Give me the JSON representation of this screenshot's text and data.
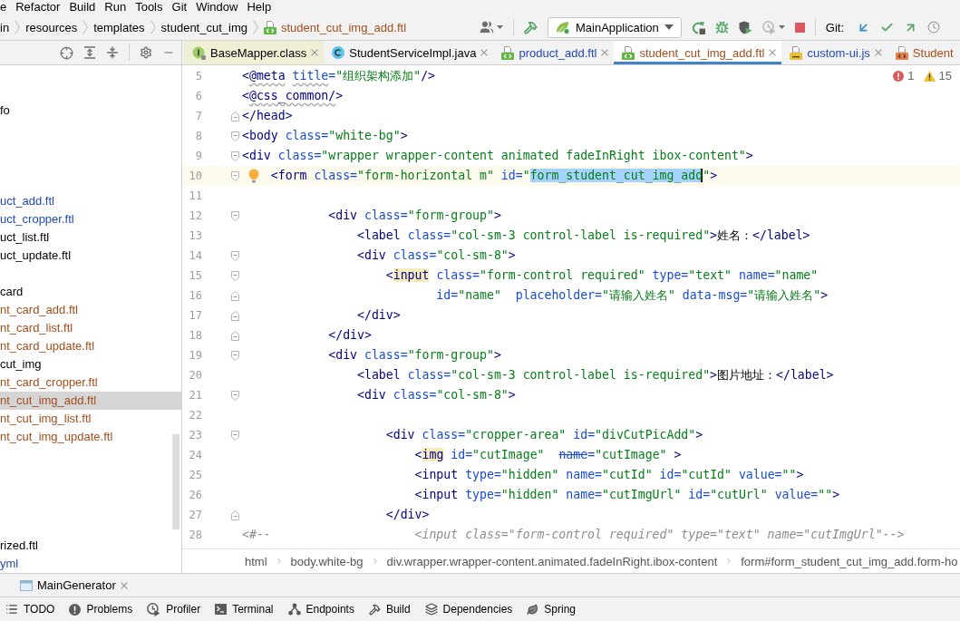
{
  "menu_bar": {
    "items": [
      "e",
      "Refactor",
      "Build",
      "Run",
      "Tools",
      "Git",
      "Window",
      "Help"
    ]
  },
  "nav_bar": {
    "breadcrumbs": [
      {
        "label": "in",
        "kind": "folder"
      },
      {
        "label": "resources",
        "kind": "folder"
      },
      {
        "label": "templates",
        "kind": "folder"
      },
      {
        "label": "student_cut_img",
        "kind": "folder"
      },
      {
        "label": "student_cut_img_add.ftl",
        "kind": "ftl",
        "color": "#a34e1c"
      }
    ]
  },
  "toolbar": {
    "run_config": "MainApplication",
    "run_actions": [
      {
        "kind": "rerun",
        "disabled": false
      },
      {
        "kind": "debug",
        "disabled": false
      },
      {
        "kind": "coverage",
        "disabled": false
      },
      {
        "kind": "profile",
        "disabled": true
      },
      {
        "kind": "stop",
        "disabled": false
      }
    ],
    "git_label": "Git:"
  },
  "project_tree": {
    "groups": [
      {
        "items": [
          {
            "label": "fo",
            "selected": false
          }
        ]
      },
      {
        "items": [
          {
            "label": "uct_add.ftl",
            "color": "#2148b8",
            "selected": false
          },
          {
            "label": "uct_cropper.ftl",
            "color": "#2148b8",
            "selected": false
          },
          {
            "label": "uct_list.ftl",
            "selected": false
          },
          {
            "label": "uct_update.ftl",
            "selected": false
          }
        ]
      },
      {
        "items": [
          {
            "label": "card",
            "selected": false
          },
          {
            "label": "nt_card_add.ftl",
            "color": "#a34e1c",
            "selected": false
          },
          {
            "label": "nt_card_list.ftl",
            "color": "#a34e1c",
            "selected": false
          },
          {
            "label": "nt_card_update.ftl",
            "color": "#a34e1c",
            "selected": false
          },
          {
            "label": "cut_img",
            "selected": false
          },
          {
            "label": "nt_card_cropper.ftl",
            "color": "#a34e1c",
            "selected": false
          },
          {
            "label": "nt_cut_img_add.ftl",
            "color": "#a34e1c",
            "selected": true
          },
          {
            "label": "nt_cut_img_list.ftl",
            "color": "#a34e1c",
            "selected": false
          },
          {
            "label": "nt_cut_img_update.ftl",
            "color": "#a34e1c",
            "selected": false
          }
        ]
      },
      {
        "items": [
          {
            "label": "rized.ftl",
            "selected": false
          },
          {
            "label": "yml",
            "color": "#2148b8",
            "selected": false
          }
        ]
      }
    ]
  },
  "editor": {
    "tabs": [
      {
        "label": "BaseMapper.class",
        "kind": "interface",
        "library": true,
        "selected": false
      },
      {
        "label": "StudentServiceImpl.java",
        "kind": "class",
        "library": false,
        "selected": false
      },
      {
        "label": "product_add.ftl",
        "kind": "ftl",
        "color": "#2148b8",
        "library": false,
        "selected": false
      },
      {
        "label": "student_cut_img_add.ftl",
        "kind": "ftl",
        "color": "#a34e1c",
        "library": false,
        "selected": true
      },
      {
        "label": "custom-ui.js",
        "kind": "js",
        "color": "#2148b8",
        "library": false,
        "selected": false
      },
      {
        "label": "Student",
        "kind": "html",
        "color": "#a34e1c",
        "library": false,
        "selected": false
      }
    ],
    "inspections": {
      "errors": "1",
      "warnings": "15"
    },
    "lines": [
      {
        "number": "5",
        "kind": "code",
        "segments": [
          {
            "text": "<"
          },
          {
            "text": "@meta title",
            "kind": "warning"
          },
          {
            "text": "=\"组织架构添加\"/>"
          }
        ]
      },
      {
        "number": "6",
        "kind": "code",
        "segments": [
          {
            "text": "<"
          },
          {
            "text": "@css_common/",
            "kind": "warning"
          },
          {
            "text": ">"
          }
        ]
      },
      {
        "number": "7",
        "kind": "code",
        "fold_end": true,
        "segments": [
          {
            "text": "</head>"
          }
        ]
      },
      {
        "number": "8",
        "kind": "code",
        "fold_start": true,
        "segments": [
          {
            "text": "<body class=\"white-bg\">"
          }
        ]
      },
      {
        "number": "9",
        "kind": "code",
        "fold_start": true,
        "segments": [
          {
            "text": "<div class=\"wrapper wrapper-content animated fadeInRight ibox-content\">"
          }
        ]
      },
      {
        "number": "10",
        "kind": "code",
        "fold_start": true,
        "current": true,
        "bulb": true,
        "segments": [
          {
            "text": "    <form class=\"form-horizontal m\" id=\""
          },
          {
            "text": "form_student_cut_img_add",
            "kind": "selection"
          },
          {
            "text": "\">"
          }
        ]
      },
      {
        "number": "11",
        "kind": "code"
      },
      {
        "number": "12",
        "kind": "code",
        "fold_start": true,
        "segments": [
          {
            "text": "            <div class=\"form-group\">"
          }
        ]
      },
      {
        "number": "13",
        "kind": "code",
        "segments": [
          {
            "text": "                <label class=\"col-sm-3 control-label is-required\">姓名：</label>"
          }
        ]
      },
      {
        "number": "14",
        "kind": "code",
        "fold_start": true,
        "segments": [
          {
            "text": "                <div class=\"col-sm-8\">"
          }
        ]
      },
      {
        "number": "15",
        "kind": "code",
        "fold_start": true,
        "segments": [
          {
            "text": "                    <"
          },
          {
            "text": "input",
            "kind": "highlight"
          },
          {
            "text": " class=\"form-control required\" type=\"text\" name=\"name\""
          }
        ]
      },
      {
        "number": "16",
        "kind": "code",
        "fold_end": true,
        "segments": [
          {
            "text": "                           id=\"name\"  placeholder=\"请输入姓名\" data-msg=\"请输入姓名\">"
          }
        ]
      },
      {
        "number": "17",
        "kind": "code",
        "fold_end": true,
        "segments": [
          {
            "text": "                </div>"
          }
        ]
      },
      {
        "number": "18",
        "kind": "code",
        "fold_end": true,
        "segments": [
          {
            "text": "            </div>"
          }
        ]
      },
      {
        "number": "19",
        "kind": "code",
        "fold_start": true,
        "segments": [
          {
            "text": "            <div class=\"form-group\">"
          }
        ]
      },
      {
        "number": "20",
        "kind": "code",
        "segments": [
          {
            "text": "                <label class=\"col-sm-3 control-label is-required\">图片地址：</label>"
          }
        ]
      },
      {
        "number": "21",
        "kind": "code",
        "fold_start": true,
        "segments": [
          {
            "text": "                <div class=\"col-sm-8\">"
          }
        ]
      },
      {
        "number": "22",
        "kind": "code"
      },
      {
        "number": "23",
        "kind": "code",
        "fold_start": true,
        "segments": [
          {
            "text": "                    <div class=\"cropper-area\" id=\"divCutPicAdd\">"
          }
        ]
      },
      {
        "number": "24",
        "kind": "code",
        "segments": [
          {
            "text": "                        <"
          },
          {
            "text": "img",
            "kind": "highlight"
          },
          {
            "text": " id=\"cutImage\"  "
          },
          {
            "text": "name",
            "kind": "deprecated"
          },
          {
            "text": "=\"cutImage\" >"
          }
        ]
      },
      {
        "number": "25",
        "kind": "code",
        "segments": [
          {
            "text": "                        <input type=\"hidden\" name=\"cutId\" id=\"cutId\" value=\"\">"
          }
        ]
      },
      {
        "number": "26",
        "kind": "code",
        "segments": [
          {
            "text": "                        <input type=\"hidden\" name=\"cutImgUrl\" id=\"cutUrl\" value=\"\">"
          }
        ]
      },
      {
        "number": "27",
        "kind": "code",
        "fold_end": true,
        "segments": [
          {
            "text": "                    </div>"
          }
        ]
      },
      {
        "number": "28",
        "kind": "comment",
        "segments": [
          {
            "text": "<#--                    <input class=\"form-control required\" type=\"text\" name=\"cutImgUrl\"-->"
          }
        ]
      }
    ],
    "breadcrumbs": [
      "html",
      "body.white-bg",
      "div.wrapper.wrapper-content.animated.fadeInRight.ibox-content",
      "form#form_student_cut_img_add.form-ho"
    ]
  },
  "run_panel": {
    "tabs": [
      {
        "label": "MainGenerator"
      }
    ]
  },
  "tool_stripe": {
    "items": [
      {
        "label": "TODO",
        "kind": "todo"
      },
      {
        "label": "Problems",
        "kind": "problems"
      },
      {
        "label": "Profiler",
        "kind": "profiler"
      },
      {
        "label": "Terminal",
        "kind": "terminal"
      },
      {
        "label": "Endpoints",
        "kind": "endpoints"
      },
      {
        "label": "Build",
        "kind": "build"
      },
      {
        "label": "Dependencies",
        "kind": "dependencies"
      },
      {
        "label": "Spring",
        "kind": "spring"
      }
    ]
  }
}
